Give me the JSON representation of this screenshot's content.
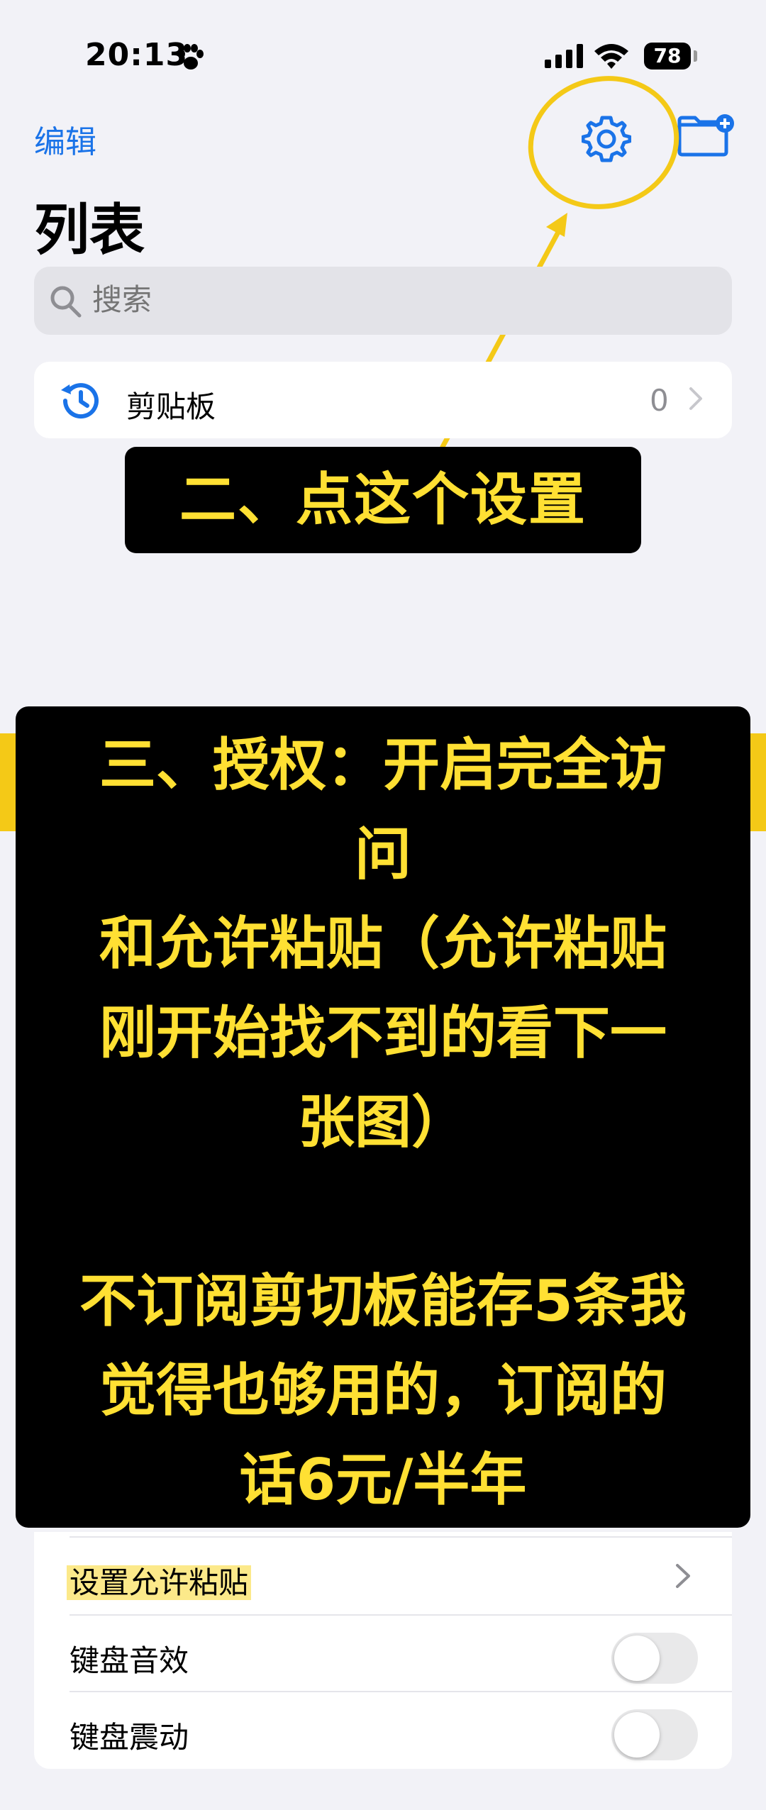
{
  "status_bar": {
    "time": "20:13",
    "battery": "78"
  },
  "nav": {
    "edit_label": "编辑"
  },
  "title": "列表",
  "search": {
    "placeholder": "搜索"
  },
  "list": [
    {
      "label": "剪贴板",
      "count": "0"
    }
  ],
  "annotation_step2": "二、点这个设置",
  "annotation_step3": {
    "lines": [
      "三、授权：开启完全访",
      "问",
      "和允许粘贴（允许粘贴",
      "刚开始找不到的看下一",
      "张图）"
    ],
    "lines2": [
      "不订阅剪切板能存5条我",
      "觉得也够用的，订阅的",
      "话6元/半年"
    ]
  },
  "settings": [
    {
      "label": "设置允许粘贴",
      "control": "chevron"
    },
    {
      "label": "键盘音效",
      "control": "toggle",
      "on": false
    },
    {
      "label": "键盘震动",
      "control": "toggle",
      "on": false
    }
  ],
  "colors": {
    "accent": "#1a73e8",
    "annotation_yellow": "#f4c917",
    "annotation_text": "#ffe033"
  },
  "icons": [
    "paw-icon",
    "signal-icon",
    "wifi-icon",
    "gear-icon",
    "folder-add-icon",
    "search-icon",
    "history-icon",
    "chevron-right-icon"
  ]
}
